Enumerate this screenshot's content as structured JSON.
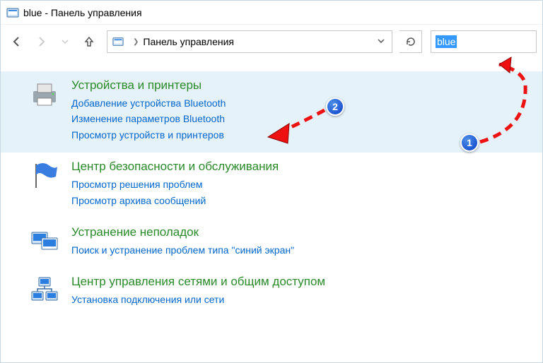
{
  "window": {
    "title": "blue - Панель управления"
  },
  "nav": {
    "address": "Панель управления"
  },
  "search": {
    "value": "blue"
  },
  "results": [
    {
      "title": "Устройства и принтеры",
      "links": [
        "Добавление устройства Bluetooth",
        "Изменение параметров Bluetooth",
        "Просмотр устройств и принтеров"
      ],
      "selected": true,
      "icon": "printer-icon"
    },
    {
      "title": "Центр безопасности и обслуживания",
      "links": [
        "Просмотр решения проблем",
        "Просмотр архива сообщений"
      ],
      "selected": false,
      "icon": "flag-icon"
    },
    {
      "title": "Устранение неполадок",
      "links": [
        "Поиск и устранение проблем типа \"синий экран\""
      ],
      "selected": false,
      "icon": "troubleshoot-icon"
    },
    {
      "title": "Центр управления сетями и общим доступом",
      "links": [
        "Установка подключения или сети"
      ],
      "selected": false,
      "icon": "network-icon"
    }
  ],
  "annotations": {
    "badge1": "1",
    "badge2": "2"
  }
}
